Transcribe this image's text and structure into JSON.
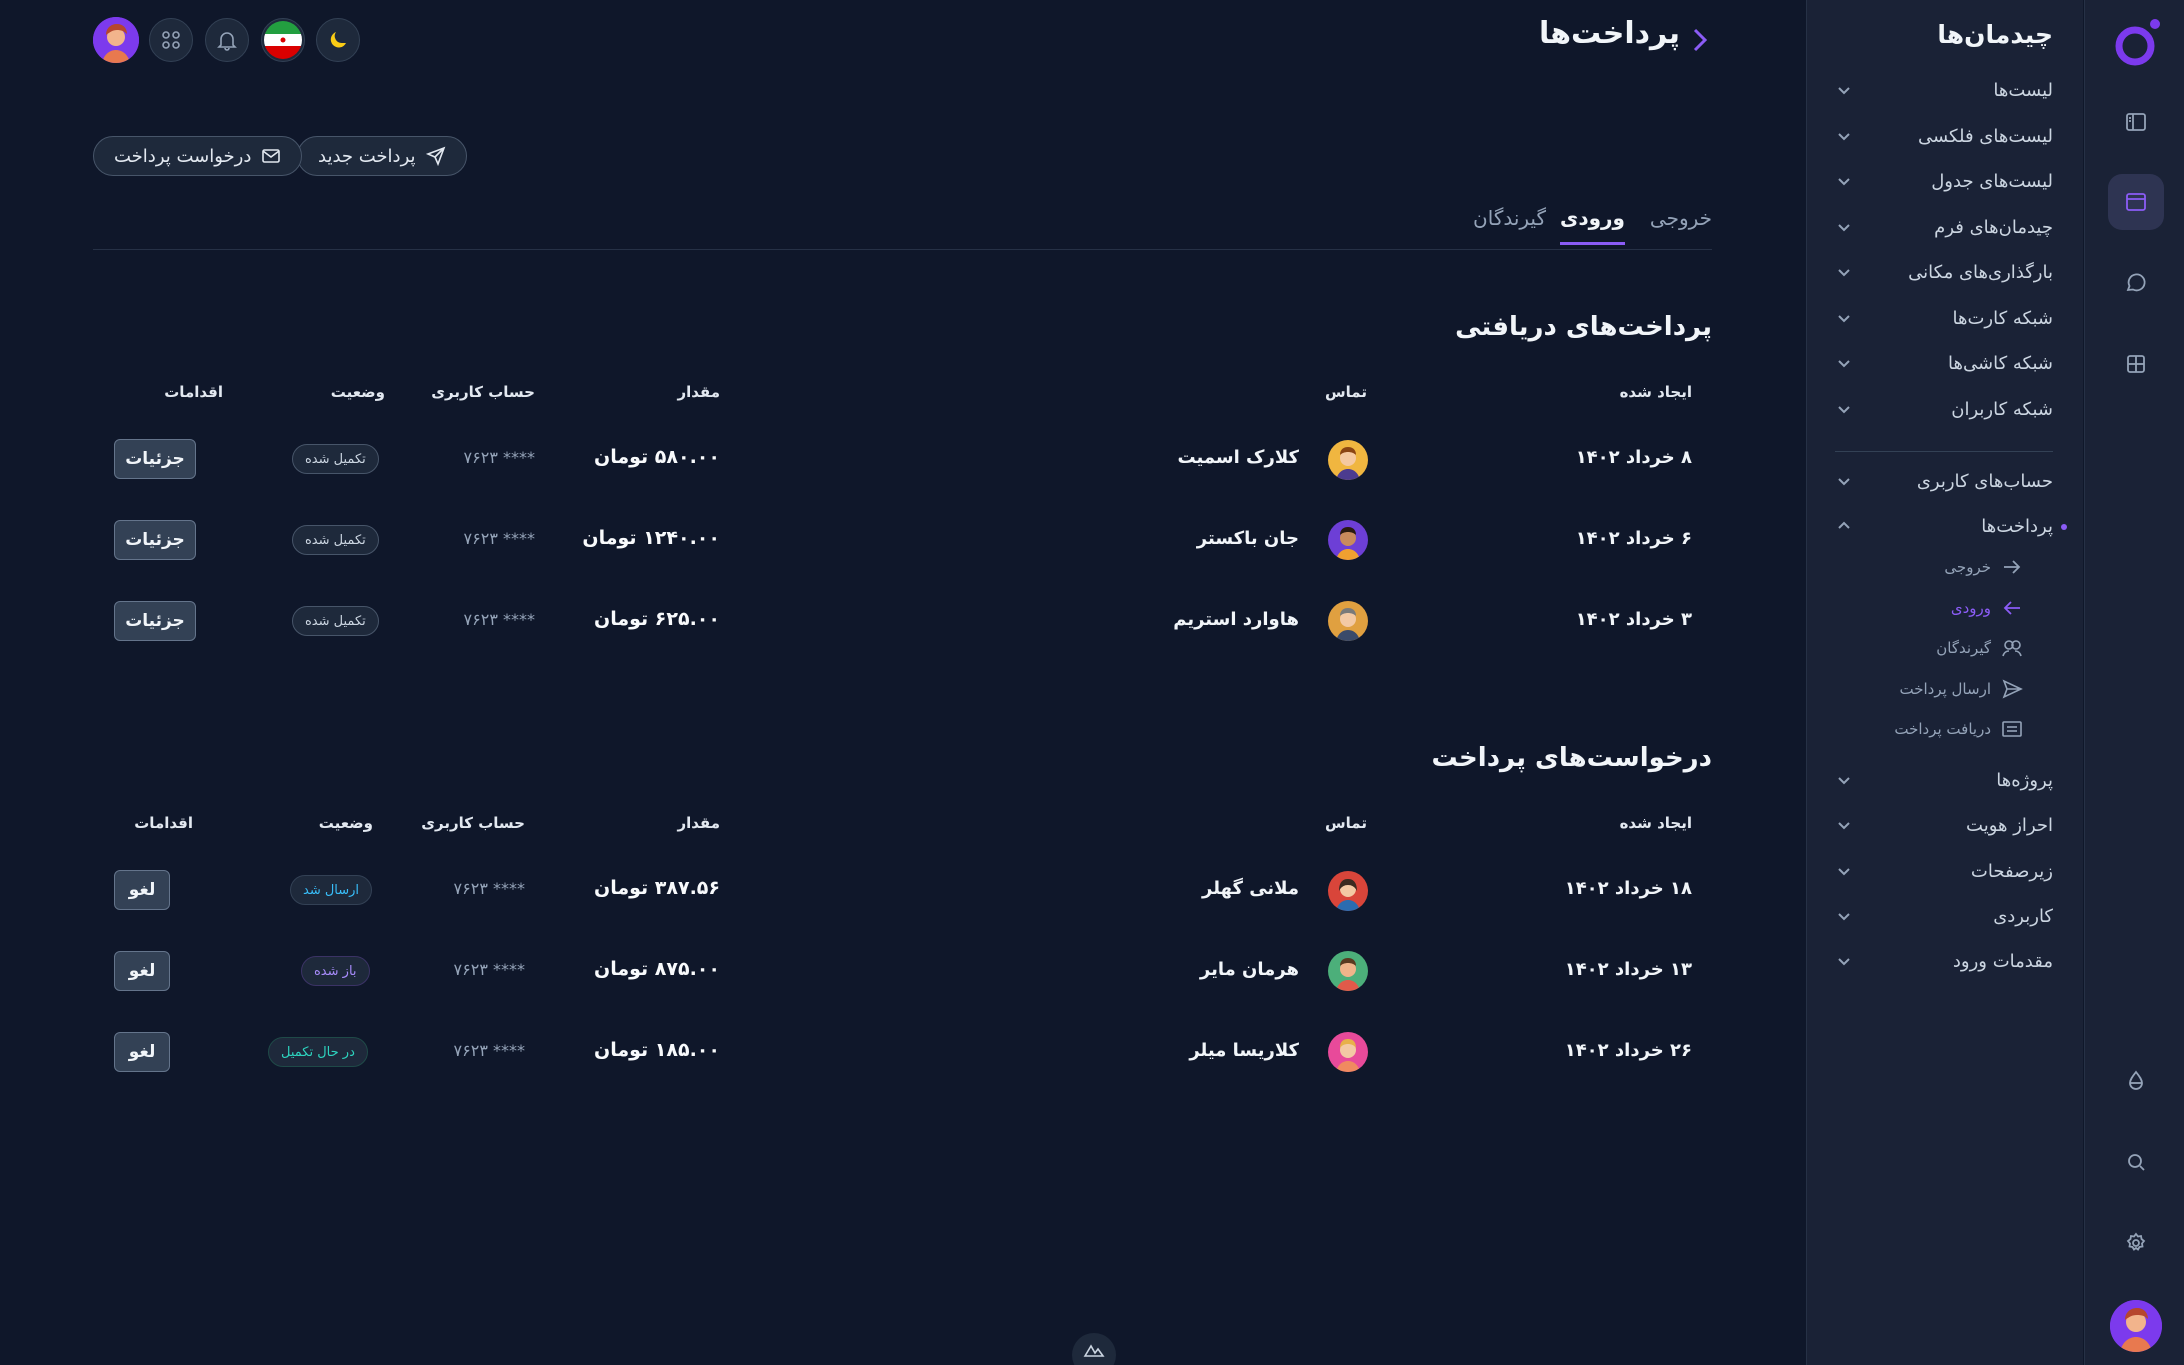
{
  "sidebar": {
    "title": "چیدمان‌ها",
    "items": [
      {
        "label": "لیست‌ها"
      },
      {
        "label": "لیست‌های فلکسی"
      },
      {
        "label": "لیست‌های جدول"
      },
      {
        "label": "چیدمان‌های فرم"
      },
      {
        "label": "بارگذاری‌های مکانی"
      },
      {
        "label": "شبکه کارت‌ها"
      },
      {
        "label": "شبکه کاشی‌ها"
      },
      {
        "label": "شبکه کاربران"
      }
    ],
    "items2": [
      {
        "label": "حساب‌های کاربری"
      },
      {
        "label": "پرداخت‌ها"
      }
    ],
    "sub": [
      {
        "label": "خروجی"
      },
      {
        "label": "ورودی"
      },
      {
        "label": "گیرندگان"
      },
      {
        "label": "ارسال پرداخت"
      },
      {
        "label": "دریافت پرداخت"
      }
    ],
    "items3": [
      {
        "label": "پروژه‌ها"
      },
      {
        "label": "احراز هویت"
      },
      {
        "label": "زیرصفحات"
      },
      {
        "label": "کاربردی"
      },
      {
        "label": "مقدمات ورود"
      }
    ]
  },
  "header": {
    "title": "پرداخت‌ها"
  },
  "actions": {
    "new_payment": "پرداخت جدید",
    "request_payment": "درخواست پرداخت"
  },
  "tabs": [
    {
      "label": "خروجی"
    },
    {
      "label": "ورودی"
    },
    {
      "label": "گیرندگان"
    }
  ],
  "received": {
    "title": "پرداخت‌های دریافتی",
    "headers": {
      "created": "ایجاد شده",
      "contact": "تماس",
      "amount": "مقدار",
      "account": "حساب کاربری",
      "status": "وضعیت",
      "actions": "اقدامات"
    },
    "rows": [
      {
        "date": "۸ خرداد ۱۴۰۲",
        "contact": "کلارک اسمیت",
        "amount": "۵۸۰.۰۰ تومان",
        "account": "**** ۷۶۲۳",
        "status": "تکمیل شده",
        "action": "جزئیات"
      },
      {
        "date": "۶ خرداد ۱۴۰۲",
        "contact": "جان باکستر",
        "amount": "۱۲۴۰.۰۰ تومان",
        "account": "**** ۷۶۲۳",
        "status": "تکمیل شده",
        "action": "جزئیات"
      },
      {
        "date": "۳ خرداد ۱۴۰۲",
        "contact": "هاوارد استریم",
        "amount": "۶۲۵.۰۰ تومان",
        "account": "**** ۷۶۲۳",
        "status": "تکمیل شده",
        "action": "جزئیات"
      }
    ]
  },
  "requests": {
    "title": "درخواست‌های پرداخت",
    "headers": {
      "created": "ایجاد شده",
      "contact": "تماس",
      "amount": "مقدار",
      "account": "حساب کاربری",
      "status": "وضعیت",
      "actions": "اقدامات"
    },
    "rows": [
      {
        "date": "۱۸ خرداد ۱۴۰۲",
        "contact": "ملانی گهلر",
        "amount": "۳۸۷.۵۶ تومان",
        "account": "**** ۷۶۲۳",
        "status": "ارسال شد",
        "action": "لغو"
      },
      {
        "date": "۱۳ خرداد ۱۴۰۲",
        "contact": "هرمان مایر",
        "amount": "۸۷۵.۰۰ تومان",
        "account": "**** ۷۶۲۳",
        "status": "باز شده",
        "action": "لغو"
      },
      {
        "date": "۲۶ خرداد ۱۴۰۲",
        "contact": "کلاریسا میلر",
        "amount": "۱۸۵.۰۰ تومان",
        "account": "**** ۷۶۲۳",
        "status": "در حال تکمیل",
        "action": "لغو"
      }
    ]
  },
  "colors": {
    "accent": "#8b5cf6",
    "background": "#0f172a",
    "panel": "#1a2236"
  }
}
